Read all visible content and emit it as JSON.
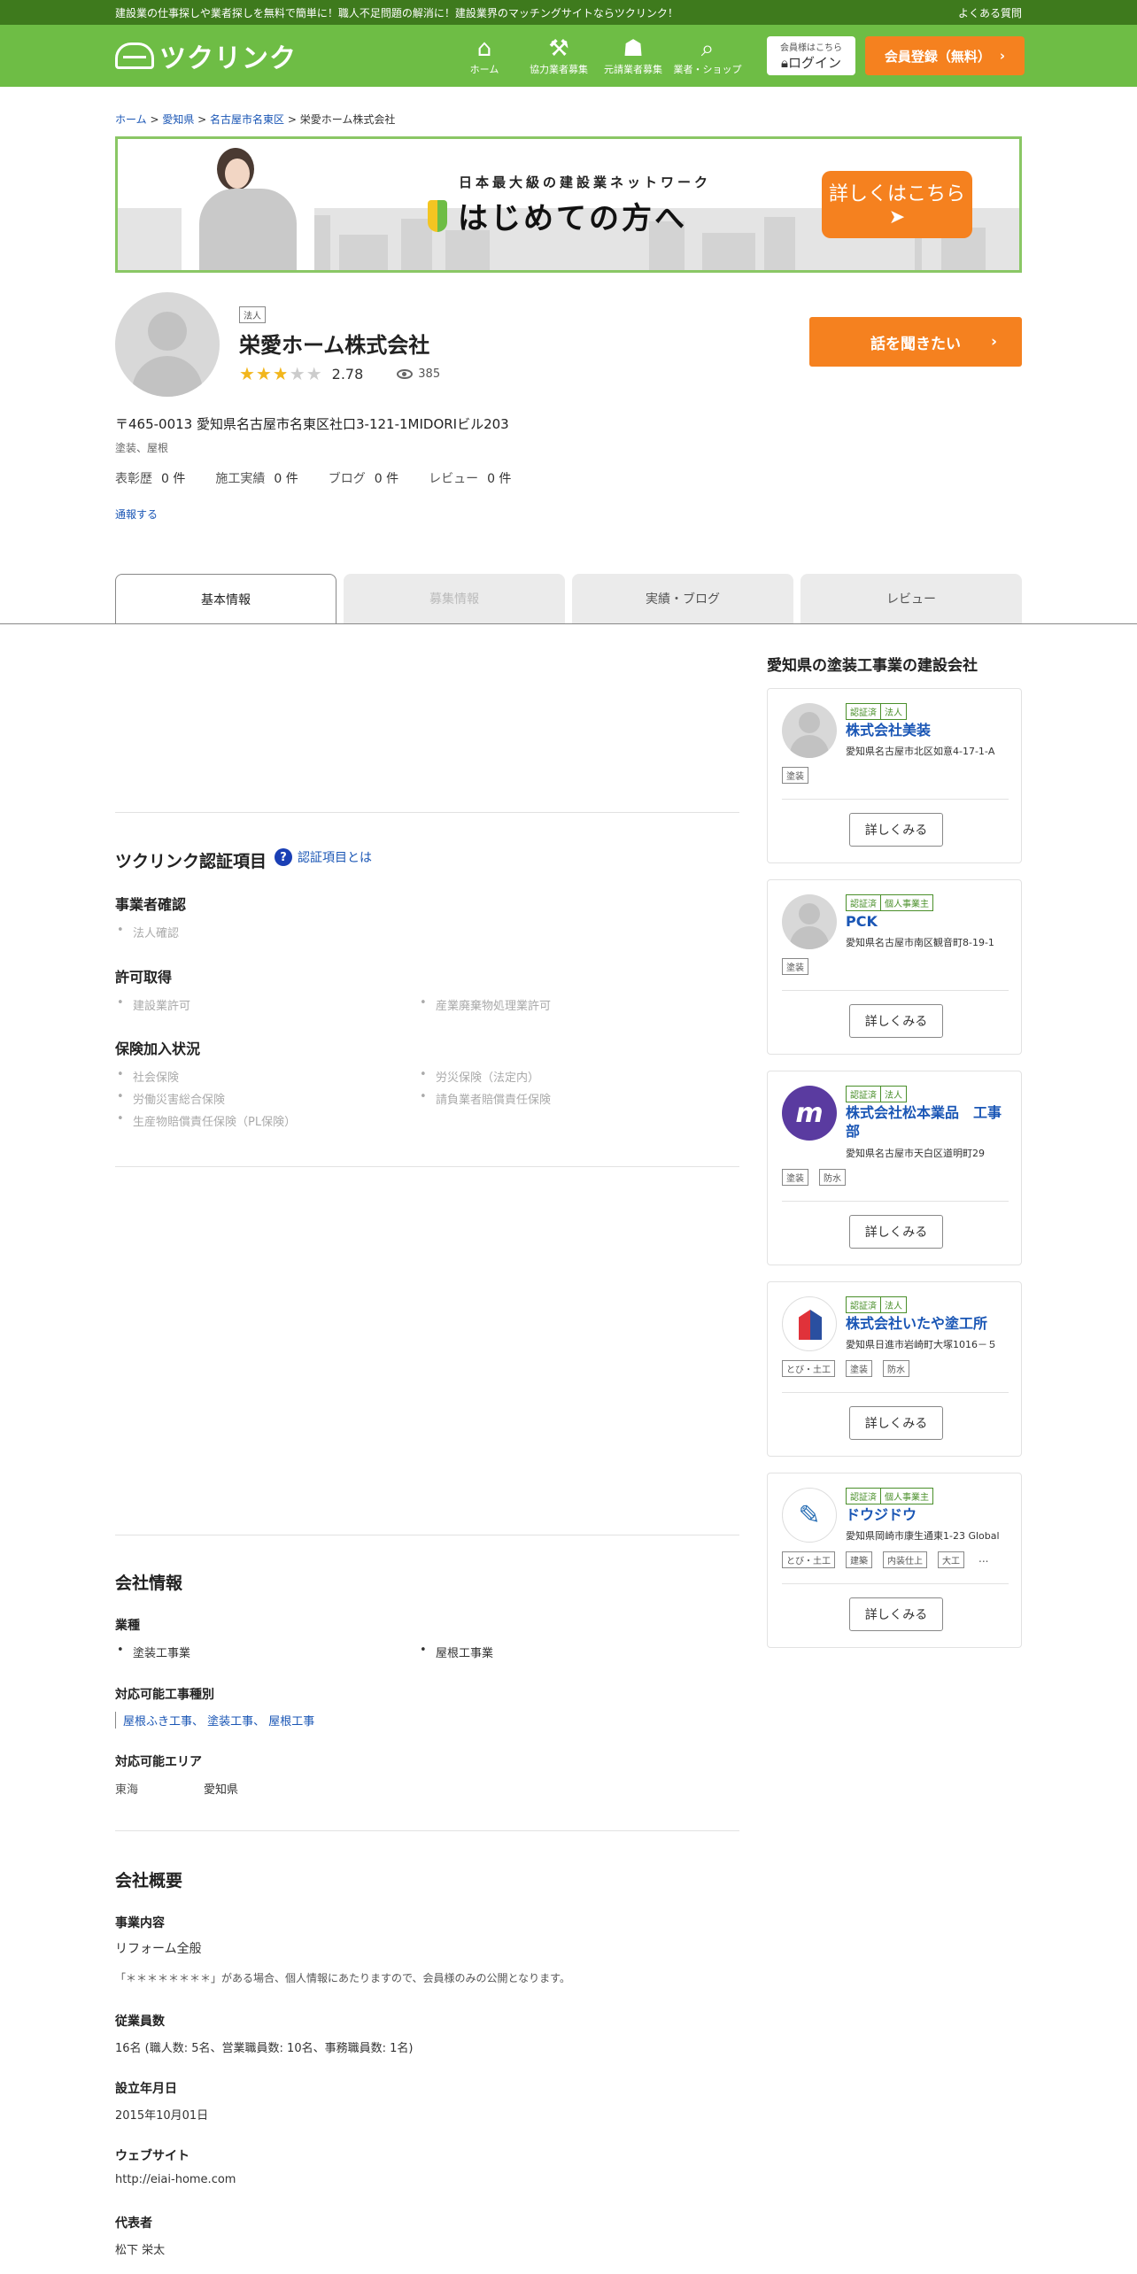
{
  "topbar": {
    "message": "建設業の仕事探しや業者探しを無料で簡単に！職人不足問題の解消に！建設業界のマッチングサイトならツクリンク！",
    "faq": "よくある質問"
  },
  "header": {
    "logo": "ツクリンク",
    "nav": [
      {
        "label": "ホーム",
        "icon": "home-icon"
      },
      {
        "label": "協力業者募集",
        "icon": "hammer-icon"
      },
      {
        "label": "元請業者募集",
        "icon": "worker-icon"
      },
      {
        "label": "業者・ショップ",
        "icon": "search-icon"
      }
    ],
    "login_small": "会員様はこちら",
    "login_label": "ログイン",
    "register_label": "会員登録（無料）"
  },
  "breadcrumb": {
    "items": [
      "ホーム",
      "愛知県",
      "名古屋市名東区"
    ],
    "current": "栄愛ホーム株式会社"
  },
  "banner": {
    "tagline": "日本最大級の建設業ネットワーク",
    "headline": "はじめての方へ",
    "cta": "詳しくはこちら"
  },
  "company": {
    "type_tag": "法人",
    "name": "栄愛ホーム株式会社",
    "rating": "2.78",
    "rating_fraction": 0.556,
    "views": "385",
    "talk_button": "話を聞きたい",
    "address": "〒465-0013 愛知県名古屋市名東区社口3-121-1MIDORIビル203",
    "trades": "塗装、屋根",
    "counts": [
      {
        "label": "表彰歴",
        "value": "0 件"
      },
      {
        "label": "施工実績",
        "value": "0 件"
      },
      {
        "label": "ブログ",
        "value": "0 件"
      },
      {
        "label": "レビュー",
        "value": "0 件"
      }
    ],
    "report": "通報する"
  },
  "tabs": [
    {
      "label": "基本情報",
      "state": "active"
    },
    {
      "label": "募集情報",
      "state": "disabled"
    },
    {
      "label": "実績・ブログ",
      "state": "normal"
    },
    {
      "label": "レビュー",
      "state": "normal"
    }
  ],
  "certification": {
    "title": "ツクリンク認証項目",
    "help_link": "認証項目とは",
    "business_check": {
      "title": "事業者確認",
      "items": [
        "法人確認"
      ]
    },
    "permits": {
      "title": "許可取得",
      "items": [
        "建設業許可",
        "産業廃棄物処理業許可"
      ]
    },
    "insurance": {
      "title": "保険加入状況",
      "items": [
        "社会保険",
        "労災保険（法定内）",
        "労働災害総合保険",
        "請負業者賠償責任保険",
        "生産物賠償責任保険（PL保険）"
      ]
    }
  },
  "company_info": {
    "title": "会社情報",
    "industry_title": "業種",
    "industries": [
      "塗装工事業",
      "屋根工事業"
    ],
    "work_types_title": "対応可能工事種別",
    "work_types": "屋根ふき工事、 塗装工事、 屋根工事",
    "areas_title": "対応可能エリア",
    "area_region": "東海",
    "area_pref": "愛知県"
  },
  "overview": {
    "title": "会社概要",
    "business_title": "事業内容",
    "business": "リフォーム全般",
    "business_note": "「＊＊＊＊＊＊＊＊」がある場合、個人情報にあたりますので、会員様のみの公開となります。",
    "employees_title": "従業員数",
    "employees": "16名 (職人数: 5名、営業職員数: 10名、事務職員数: 1名)",
    "founded_title": "設立年月日",
    "founded": "2015年10月01日",
    "website_title": "ウェブサイト",
    "website": "http://eiai-home.com",
    "rep_title": "代表者",
    "rep": "松下 栄太"
  },
  "sidebar": {
    "title": "愛知県の塗装工事業の建設会社",
    "detail_label": "詳しくみる",
    "cards": [
      {
        "badges": [
          "認証済",
          "法人"
        ],
        "name": "株式会社美装",
        "address": "愛知県名古屋市北区如意4-17-1-A",
        "tags": [
          "塗装"
        ],
        "avatar": "person"
      },
      {
        "badges": [
          "認証済",
          "個人事業主"
        ],
        "name": "PCK",
        "address": "愛知県名古屋市南区観音町8-19-1",
        "tags": [
          "塗装"
        ],
        "avatar": "person"
      },
      {
        "badges": [
          "認証済",
          "法人"
        ],
        "name": "株式会社松本業品　工事部",
        "address": "愛知県名古屋市天白区道明町29",
        "tags": [
          "塗装",
          "防水"
        ],
        "avatar": "mm-logo"
      },
      {
        "badges": [
          "認証済",
          "法人"
        ],
        "name": "株式会社いたや塗工所",
        "address": "愛知県日進市岩崎町大塚1016－５",
        "tags": [
          "とび・土工",
          "塗装",
          "防水"
        ],
        "avatar": "house-logo"
      },
      {
        "badges": [
          "認証済",
          "個人事業主"
        ],
        "name": "ドウジドウ",
        "address": "愛知県岡崎市康生通東1-23 Global",
        "tags": [
          "とび・土工",
          "建築",
          "内装仕上",
          "大工",
          "..."
        ],
        "avatar": "book-logo"
      }
    ]
  },
  "colors": {
    "brand_green": "#6ebd45",
    "dark_green": "#3e7a1d",
    "accent_orange": "#f5811f",
    "link_blue": "#1a56b5"
  }
}
